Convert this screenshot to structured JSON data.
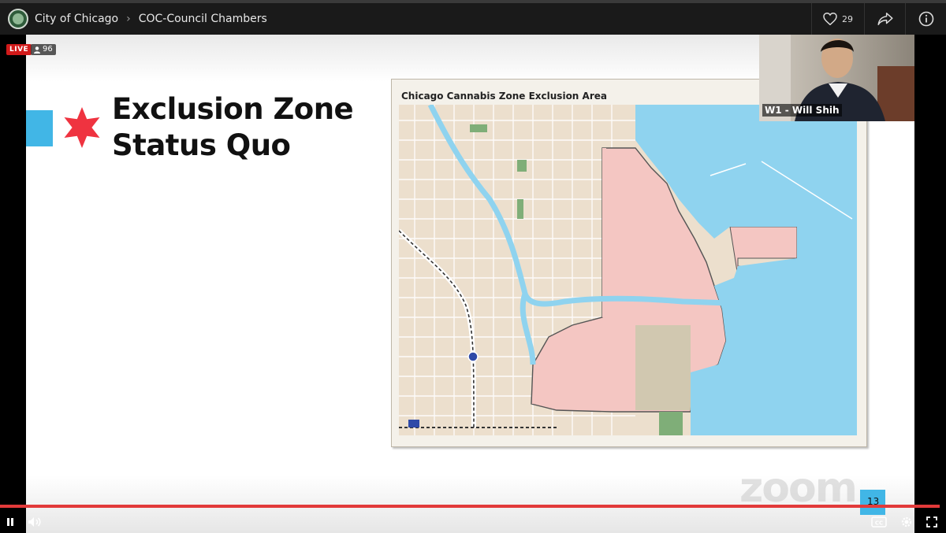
{
  "header": {
    "org_name": "City of Chicago",
    "channel_name": "COC-Council Chambers",
    "like_count": "29"
  },
  "stream": {
    "live_label": "LIVE",
    "viewer_count": "96"
  },
  "slide": {
    "title_line1": "Exclusion Zone",
    "title_line2": "Status Quo",
    "map_title": "Chicago Cannabis Zone Exclusion Area",
    "slide_number": "13",
    "watermark": "zoom"
  },
  "speaker": {
    "label": "W1 - Will Shih"
  },
  "playback": {
    "progress": 0.993
  },
  "colors": {
    "live_red": "#d11a1a",
    "chicago_star_red": "#ef3340",
    "chicago_blue": "#41b6e6",
    "exclusion_zone_fill": "#f4c6c2",
    "lake": "#8fd3ef"
  }
}
